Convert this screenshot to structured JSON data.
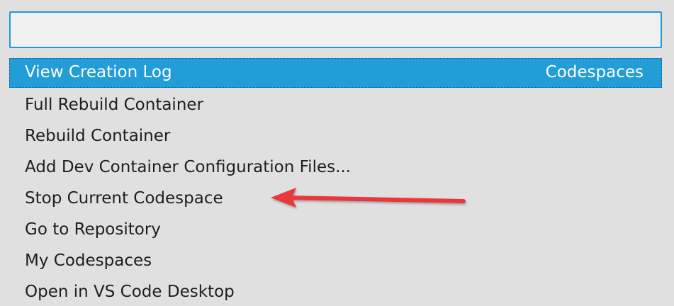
{
  "search": {
    "value": "",
    "placeholder": ""
  },
  "items": [
    {
      "label": "View Creation Log",
      "detail": "Codespaces",
      "selected": true
    },
    {
      "label": "Full Rebuild Container",
      "detail": ""
    },
    {
      "label": "Rebuild Container",
      "detail": ""
    },
    {
      "label": "Add Dev Container Configuration Files...",
      "detail": ""
    },
    {
      "label": "Stop Current Codespace",
      "detail": ""
    },
    {
      "label": "Go to Repository",
      "detail": ""
    },
    {
      "label": "My Codespaces",
      "detail": ""
    },
    {
      "label": "Open in VS Code Desktop",
      "detail": ""
    }
  ],
  "colors": {
    "background": "#e0e0e0",
    "selection": "#229dd7",
    "focus_border": "#1f9ad6",
    "annotation_arrow": "#e8393c"
  },
  "annotation": {
    "icon": "red-arrow-icon",
    "points_to": "Stop Current Codespace"
  }
}
